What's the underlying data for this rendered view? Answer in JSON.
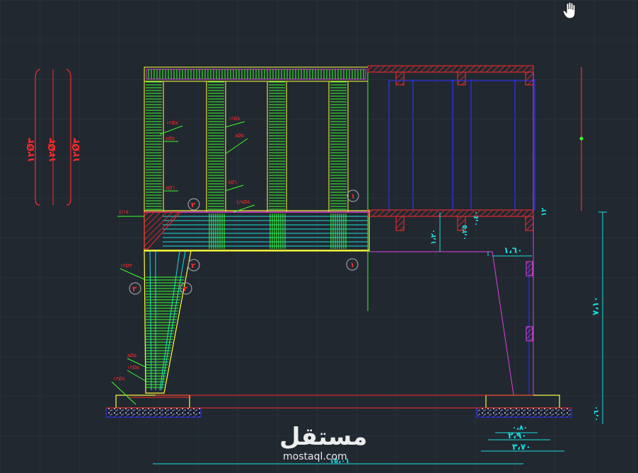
{
  "drawing": {
    "rebar_labels_left": [
      "١٢Ø٣",
      "١٢Ø٣",
      "١٢Ø٣"
    ],
    "stirrup_labels": [
      {
        "text": "١٢Ø٨"
      },
      {
        "text": "٨Ø٥"
      },
      {
        "text": "٨Ø٦"
      },
      {
        "text": "١٢Ø٨"
      },
      {
        "text": "٨Ø٥"
      },
      {
        "text": "٨Ø٦"
      },
      {
        "text": "٤/٨Ø٥"
      },
      {
        "text": "٤/١٥٠"
      },
      {
        "text": "١٢Ø٣"
      },
      {
        "text": "٨Ø٥"
      },
      {
        "text": "١٢Ø٥"
      },
      {
        "text": "١٢Ø٨"
      }
    ],
    "section_bubbles": [
      "٢",
      "١",
      "٢",
      "١",
      "٣",
      "٣"
    ],
    "dimensions": {
      "d_120": "١،٢٠",
      "d_160": "١،٦٠",
      "d_25": "٠،٢٥",
      "d_40": "٠،٤٠",
      "d_12": "١٢",
      "d_710": "٧،١٠",
      "d_070": "٠،٦٠",
      "d_080": "٠،٨٠",
      "d_290": "٢،٩٠",
      "d_370": "٣،٧٠",
      "d_1501": "١٥،٠١"
    },
    "colors": {
      "background": "#212830",
      "grid": "#2a3540",
      "green_rebar": "#3cff2c",
      "yellow": "#ffff3a",
      "red": "#ff2a2a",
      "magenta": "#e040e0",
      "blue": "#3030ff",
      "cyan": "#16e0e0"
    }
  },
  "cursor": {
    "icon": "hand-pan-icon"
  },
  "watermark": {
    "arabic": "مستقل",
    "latin": "mostaql.com"
  }
}
